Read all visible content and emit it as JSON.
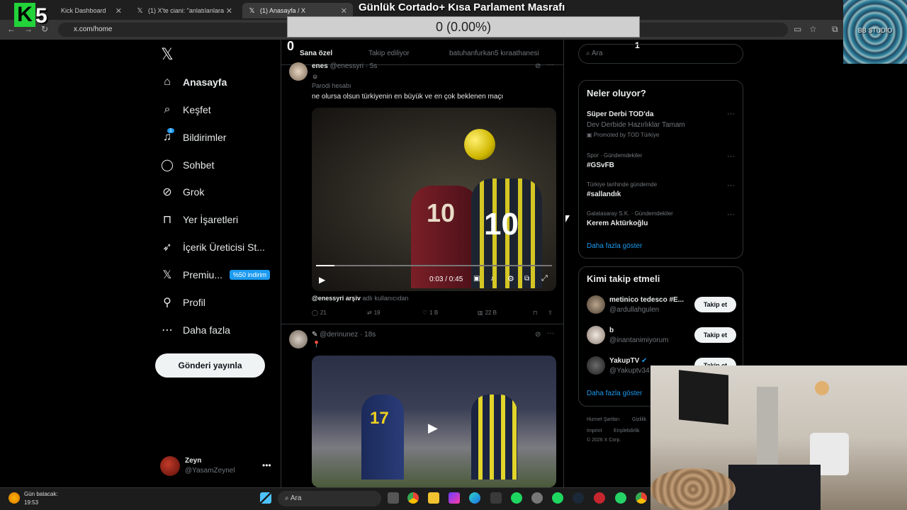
{
  "browser": {
    "tabs": [
      {
        "label": "Kick Dashboard"
      },
      {
        "label": "(1) X'te ciani: \"anlatılanlara göre"
      },
      {
        "label": "(1) Anasayfa / X"
      }
    ],
    "url": "x.com/home"
  },
  "overlay": {
    "stream_title": "Günlük Cortado+ Kısa Parlament Masrafı",
    "progress_text": "0 (0.00%)",
    "count_left": "0",
    "count_right": "1",
    "studio_label": "BB STUDIO",
    "logo_k": "K",
    "logo_5": "5"
  },
  "nav": {
    "items": [
      {
        "label": "Anasayfa",
        "icon": "home-icon"
      },
      {
        "label": "Keşfet",
        "icon": "search-icon"
      },
      {
        "label": "Bildirimler",
        "icon": "bell-icon",
        "badge": "1"
      },
      {
        "label": "Sohbet",
        "icon": "chat-icon"
      },
      {
        "label": "Grok",
        "icon": "grok-icon"
      },
      {
        "label": "Yer İşaretleri",
        "icon": "bookmark-icon"
      },
      {
        "label": "İçerik Üreticisi St...",
        "icon": "rocket-icon"
      },
      {
        "label": "Premiu...",
        "icon": "x-logo-icon",
        "promo": "%50 indirim"
      },
      {
        "label": "Profil",
        "icon": "person-icon"
      },
      {
        "label": "Daha fazla",
        "icon": "more-circle-icon"
      }
    ],
    "post_button": "Gönderi yayınla"
  },
  "account": {
    "name": "Zeyn",
    "handle": "@YasamZeynel"
  },
  "feed": {
    "tabs": [
      "Sana özel",
      "Takip ediliyor",
      "batuhanfurkan5 kıraathanesi"
    ],
    "tweet1": {
      "name": "enes",
      "handle": "@enessyri · 5s",
      "label": "Parodi hesabı",
      "text": "ne olursa olsun türkiyenin en büyük ve en çok beklenen maçı",
      "video_time": "0:03 / 0:45",
      "credit_handle": "@enessyri arşiv",
      "credit_suffix": "adlı kullanıcıdan",
      "replies": "21",
      "retweets": "19",
      "likes": "1 B",
      "views": "22 B",
      "jersey_left": "10",
      "jersey_right": "10"
    },
    "tweet2": {
      "handle": "@derinunez · 18s",
      "jersey": "17"
    }
  },
  "right": {
    "search_placeholder": "Ara",
    "trends_title": "Neler oluyor?",
    "trends": [
      {
        "title": "Süper Derbi TOD'da",
        "sub": "Dev Derbide Hazırlıklar Tamam",
        "meta": "Promoted by TOD Türkiye"
      },
      {
        "meta": "Spor · Gündemdekiler",
        "title": "#GSvFB"
      },
      {
        "meta": "Türkiye tarihinde gündemde",
        "title": "#sallandık"
      },
      {
        "meta": "Galatasaray S.K. · Gündemdekiler",
        "title": "Kerem Aktürkoğlu"
      }
    ],
    "show_more": "Daha fazla göster",
    "follow_title": "Kimi takip etmeli",
    "follow": [
      {
        "name": "metinico tedesco #E...",
        "handle": "@ardullahgulen"
      },
      {
        "name": "b",
        "handle": "@inantanimiyorum"
      },
      {
        "name": "YakupTV",
        "handle": "@Yakuptv34"
      }
    ],
    "follow_button": "Takip et",
    "footer": [
      "Hizmet Şartları",
      "Gizlilik",
      "Imprint",
      "Erişilebilirlik",
      "© 2026 X Corp."
    ]
  },
  "taskbar": {
    "weather_title": "Gün batacak:",
    "weather_time": "19:53",
    "search": "Ara"
  }
}
